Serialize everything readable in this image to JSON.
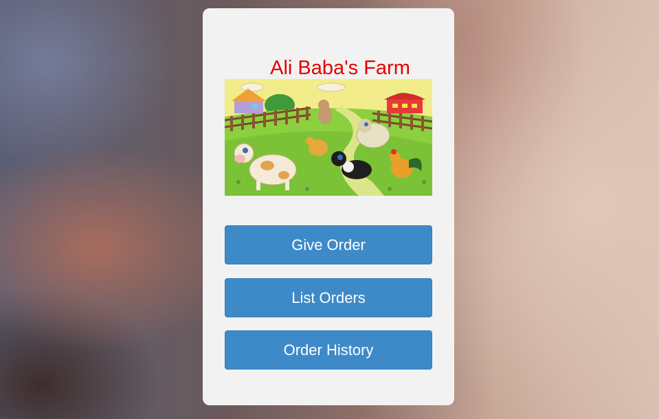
{
  "app": {
    "title": "Ali Baba's Farm"
  },
  "banner": {
    "icon": "farm-illustration"
  },
  "menu": {
    "buttons": [
      {
        "label": "Give Order"
      },
      {
        "label": "List Orders"
      },
      {
        "label": "Order History"
      }
    ]
  },
  "colors": {
    "title": "#e60000",
    "button": "#3e8ac9",
    "card": "#f2f2f2"
  }
}
